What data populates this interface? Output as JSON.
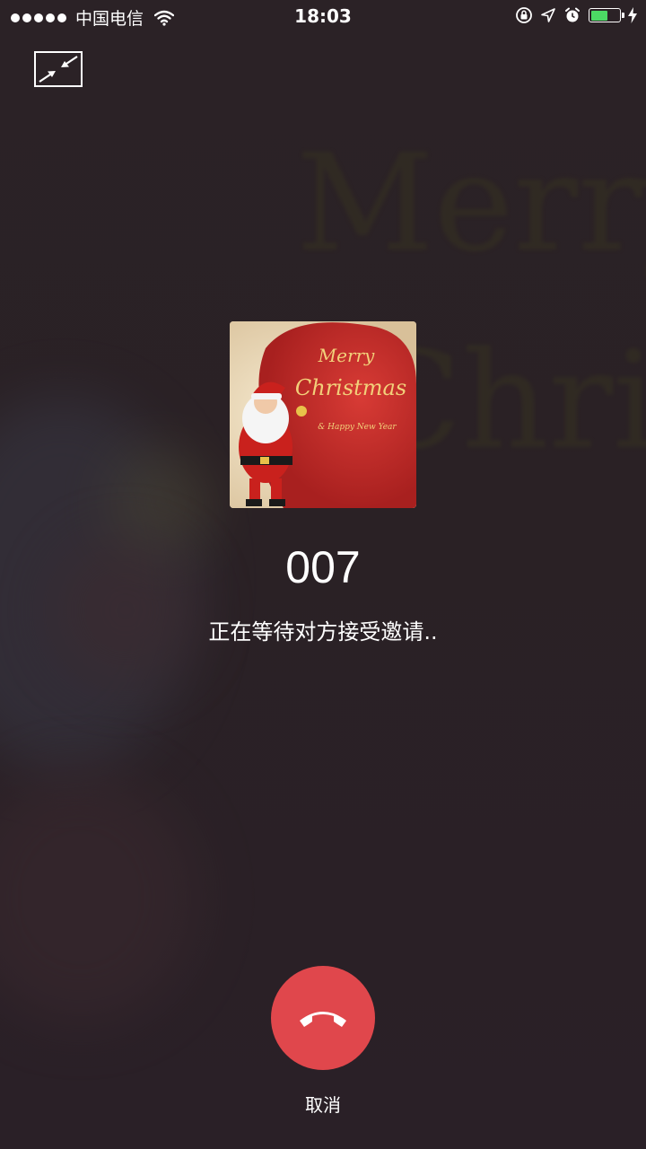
{
  "status_bar": {
    "carrier": "中国电信",
    "time": "18:03",
    "battery_level": 0.6,
    "battery_color": "#4cd964",
    "icons": [
      "signal-dots-icon",
      "wifi-icon",
      "rotation-lock-icon",
      "location-icon",
      "alarm-icon",
      "battery-icon",
      "charging-bolt-icon"
    ]
  },
  "header": {
    "minimize_icon": "minimize-arrows-icon"
  },
  "caller": {
    "name": "007",
    "status": "正在等待对方接受邀请..",
    "avatar": {
      "title": "Merry Christmas",
      "title_line1": "Merry",
      "title_line2": "Christmas",
      "subtitle": "& Happy New Year"
    }
  },
  "actions": {
    "hangup_icon": "phone-hangup-icon",
    "hangup_color": "#e0474c",
    "cancel_label": "取消"
  }
}
